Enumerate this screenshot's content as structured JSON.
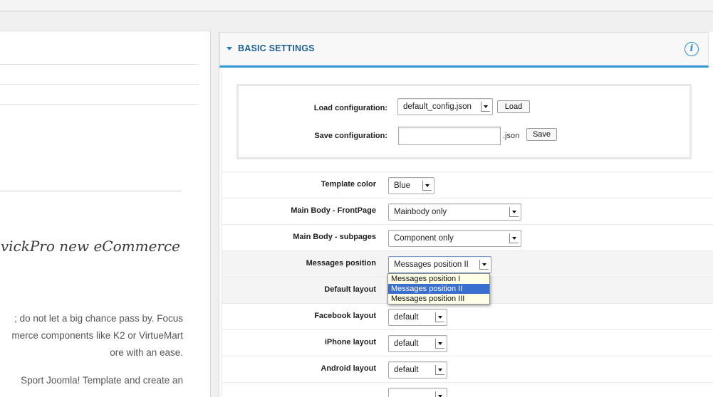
{
  "article": {
    "heading": "avickPro new eCommerce",
    "paragraph1": [
      "; do not let a big chance pass by. Focus",
      "merce components like K2 or VirtueMart",
      "ore with an ease."
    ],
    "paragraph2": [
      "Sport Joomla! Template and create an"
    ]
  },
  "panel": {
    "title": "BASIC SETTINGS",
    "info_glyph": "i"
  },
  "config": {
    "load_label": "Load configuration:",
    "load_value": "default_config.json",
    "load_button": "Load",
    "save_label": "Save configuration:",
    "save_value": "",
    "save_ext": ".json",
    "save_button": "Save"
  },
  "settings": [
    {
      "label": "Template color",
      "value": "Blue"
    },
    {
      "label": "Main Body - FrontPage",
      "value": "Mainbody only"
    },
    {
      "label": "Main Body - subpages",
      "value": "Component only"
    },
    {
      "label": "Messages position",
      "value": "Messages position II"
    },
    {
      "label": "Default layout",
      "value": ""
    },
    {
      "label": "Facebook layout",
      "value": "default"
    },
    {
      "label": "iPhone layout",
      "value": "default"
    },
    {
      "label": "Android layout",
      "value": "default"
    }
  ],
  "messages_dropdown": {
    "options": [
      "Messages position I",
      "Messages position II",
      "Messages position III"
    ],
    "selected": "Messages position II"
  }
}
